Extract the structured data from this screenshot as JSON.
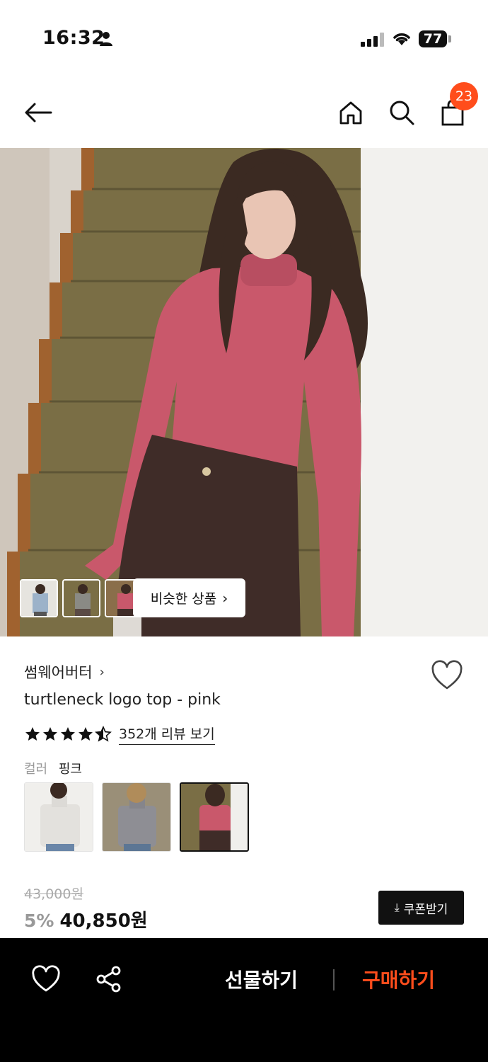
{
  "status_bar": {
    "time": "16:32",
    "battery": "77"
  },
  "nav": {
    "cart_count": "23"
  },
  "gallery": {
    "similar_label": "비슷한 상품"
  },
  "product": {
    "brand": "썸웨어버터",
    "name": "turtleneck logo top - pink",
    "rating": 4.5,
    "review_link": "352개 리뷰 보기",
    "color_label": "컬러",
    "color_value": "핑크",
    "original_price": "43,000원",
    "discount": "5%",
    "price": "40,850원",
    "coupon_label": "쿠폰받기"
  },
  "bottom_bar": {
    "gift_label": "선물하기",
    "buy_label": "구매하기"
  },
  "colors": {
    "accent": "#ff4d1c",
    "bar": "#000000"
  }
}
